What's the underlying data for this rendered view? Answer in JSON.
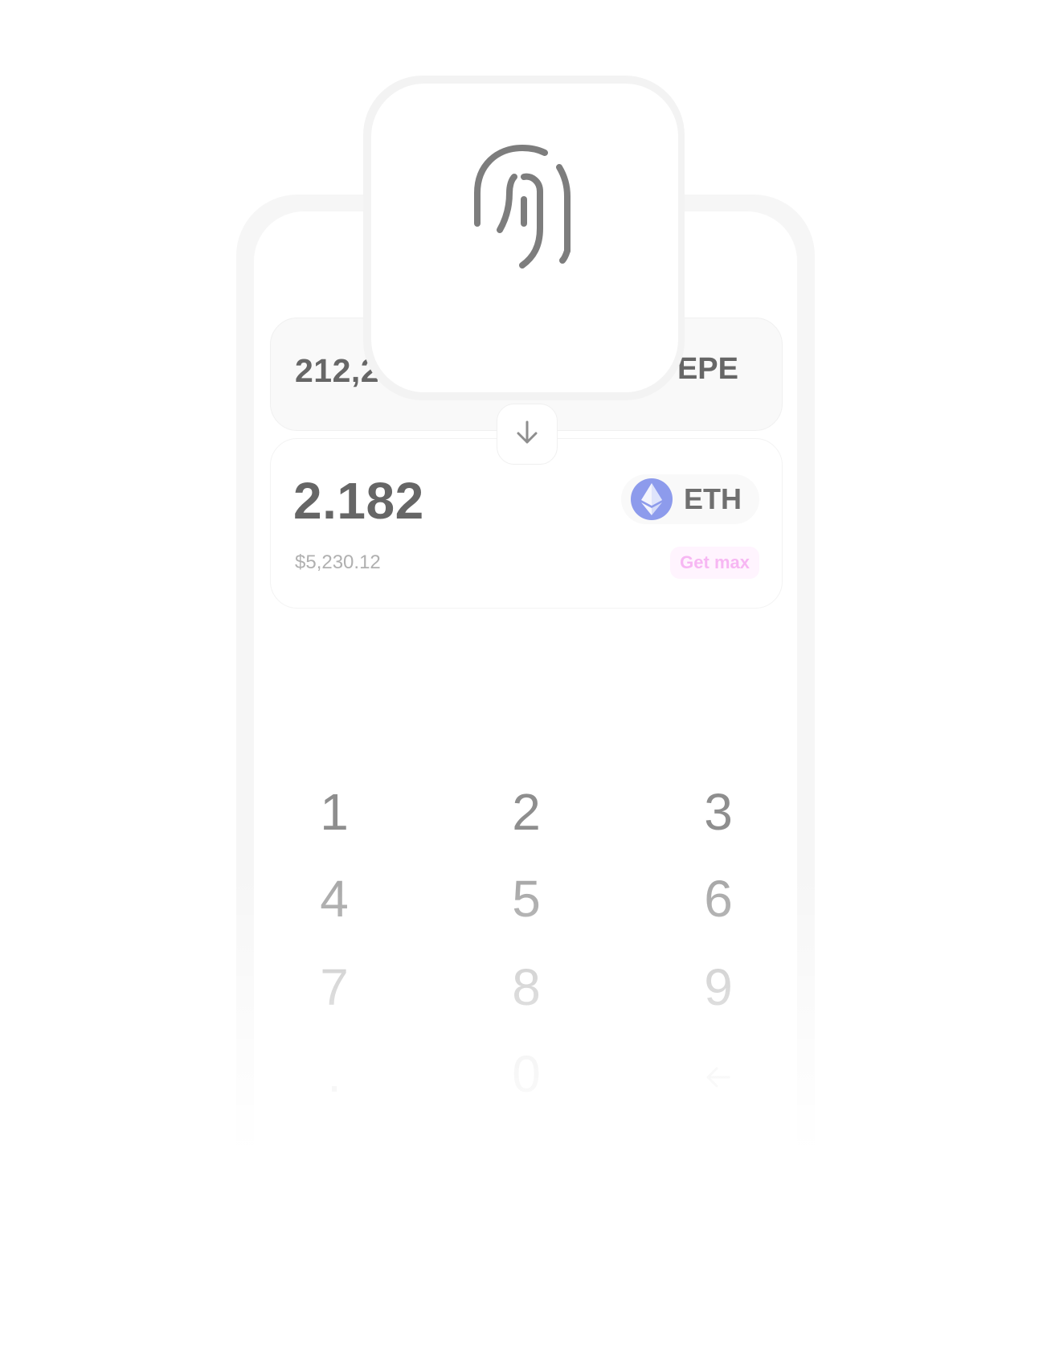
{
  "swap": {
    "from": {
      "amount": "212,2",
      "token": "PEPE"
    },
    "to": {
      "amount": "2.182",
      "usd_value": "$5,230.12",
      "token": "ETH",
      "get_max_label": "Get max"
    }
  },
  "keypad": {
    "keys": [
      "1",
      "2",
      "3",
      "4",
      "5",
      "6",
      "7",
      "8",
      "9",
      ".",
      "0"
    ]
  },
  "icons": {
    "auth": "fingerprint-icon",
    "swap": "arrow-down-icon",
    "token": "ethereum-icon",
    "backspace": "arrow-left-icon"
  },
  "colors": {
    "eth_badge": "#8d9bec",
    "get_max_text": "#f7b7f3",
    "get_max_bg": "#fff4fe"
  }
}
